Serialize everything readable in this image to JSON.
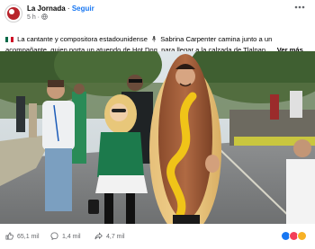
{
  "post": {
    "page_name": "La Jornada",
    "separator": "·",
    "follow_label": "Seguir",
    "timestamp": "5 h ·",
    "caption_text": "La cantante y compositora estadounidense",
    "caption_text_2": "Sabrina Carpenter camina junto a un acompañante, quien porta un atuendo de Hot Dog, para llegar a la calzada de Tlalpan, ...",
    "see_more": "Ver más"
  },
  "stats": {
    "likes": "65,1 mil",
    "comments": "1,4 mil",
    "shares": "4,7 mil"
  },
  "icons": {
    "more": "ellipsis-icon",
    "flag": "mexico-flag-icon",
    "mic": "microphone-icon",
    "like": "thumbs-up-icon",
    "comment": "comment-icon",
    "share": "share-icon",
    "globe": "globe-icon"
  },
  "colors": {
    "link": "#1877f2",
    "muted": "#65676b",
    "brand": "#b8232b"
  }
}
